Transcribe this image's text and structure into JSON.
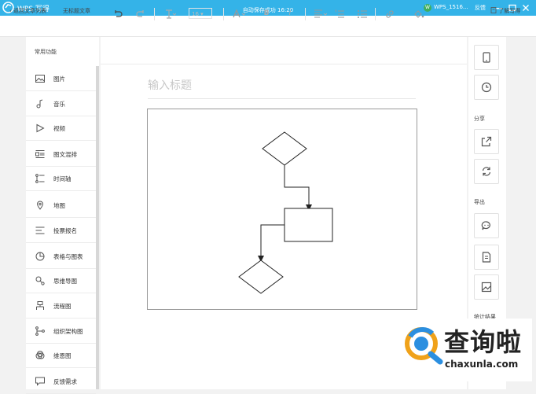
{
  "titlebar": {
    "app_name": "WPS 写得",
    "user_avatar_text": "W",
    "user_name": "WPS_1516...",
    "feedback": "反馈"
  },
  "topbar": {
    "back_label": "返回文章列表",
    "doc_name": "无标题文章",
    "save_status": "自动保存成功 16:20",
    "learn_label": "了解写得"
  },
  "sidebar": {
    "title": "常用功能",
    "items": [
      {
        "label": "图片",
        "icon": "image-icon"
      },
      {
        "label": "音乐",
        "icon": "music-icon"
      },
      {
        "label": "视频",
        "icon": "video-icon"
      },
      {
        "label": "图文混排",
        "icon": "layout-icon"
      },
      {
        "label": "时间轴",
        "icon": "timeline-icon"
      },
      {
        "label": "地图",
        "icon": "map-pin-icon"
      },
      {
        "label": "投票报名",
        "icon": "vote-icon"
      },
      {
        "label": "表格与图表",
        "icon": "chart-icon"
      },
      {
        "label": "思维导图",
        "icon": "mindmap-icon"
      },
      {
        "label": "流程图",
        "icon": "flowchart-icon"
      },
      {
        "label": "组织架构图",
        "icon": "org-chart-icon"
      },
      {
        "label": "维恩图",
        "icon": "venn-icon"
      },
      {
        "label": "反馈需求",
        "icon": "feedback-icon"
      }
    ]
  },
  "toolbar": {
    "font_size": "16"
  },
  "editor": {
    "title_placeholder": "输入标题"
  },
  "right_panel": {
    "share_label": "分享",
    "export_label": "导出",
    "stats_label": "统计结果"
  },
  "watermark": {
    "text": "查询啦",
    "url": "chaxunla.com"
  },
  "colors": {
    "accent": "#34b3e8",
    "avatar": "#3fae5f"
  }
}
